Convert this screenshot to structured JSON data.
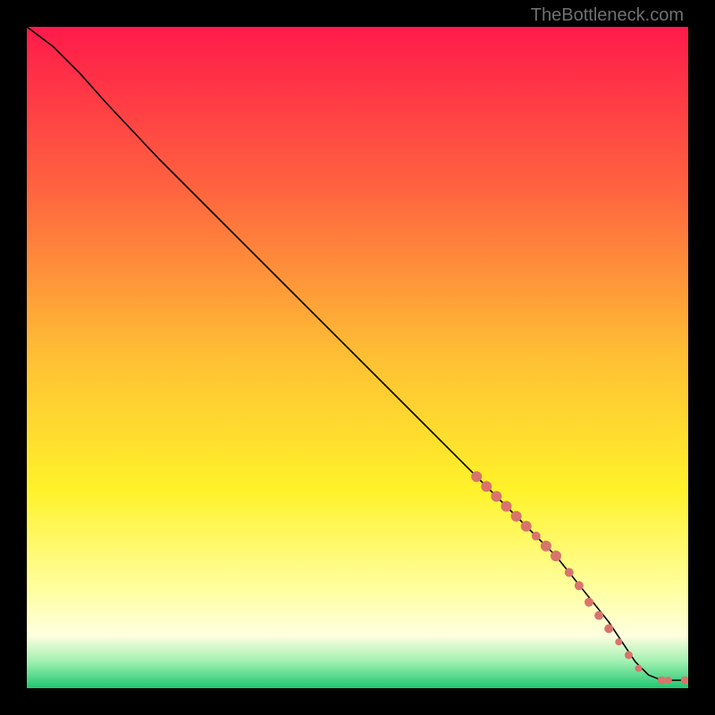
{
  "watermark": "TheBottleneck.com",
  "chart_data": {
    "type": "line",
    "title": "",
    "xlabel": "",
    "ylabel": "",
    "xlim": [
      0,
      100
    ],
    "ylim": [
      0,
      100
    ],
    "grid": false,
    "background_gradient": {
      "type": "vertical",
      "stops": [
        {
          "offset": 0.0,
          "color": "#ff1a4a"
        },
        {
          "offset": 0.25,
          "color": "#ff653f"
        },
        {
          "offset": 0.5,
          "color": "#ffc034"
        },
        {
          "offset": 0.7,
          "color": "#fff22a"
        },
        {
          "offset": 0.85,
          "color": "#ffffa0"
        },
        {
          "offset": 0.92,
          "color": "#ffffe0"
        },
        {
          "offset": 0.96,
          "color": "#a0f0b0"
        },
        {
          "offset": 1.0,
          "color": "#1fc76f"
        }
      ]
    },
    "series": [
      {
        "name": "curve",
        "type": "line",
        "color": "#000000",
        "width": 1.6,
        "points": [
          {
            "x": 0,
            "y": 100
          },
          {
            "x": 4,
            "y": 97
          },
          {
            "x": 8,
            "y": 93
          },
          {
            "x": 12,
            "y": 88.5
          },
          {
            "x": 20,
            "y": 80
          },
          {
            "x": 30,
            "y": 70
          },
          {
            "x": 40,
            "y": 60
          },
          {
            "x": 50,
            "y": 50
          },
          {
            "x": 60,
            "y": 40
          },
          {
            "x": 70,
            "y": 30
          },
          {
            "x": 80,
            "y": 20
          },
          {
            "x": 88,
            "y": 10
          },
          {
            "x": 92,
            "y": 4
          },
          {
            "x": 94,
            "y": 2
          },
          {
            "x": 96,
            "y": 1.2
          },
          {
            "x": 98,
            "y": 1.2
          },
          {
            "x": 100,
            "y": 1.2
          }
        ]
      },
      {
        "name": "markers",
        "type": "scatter",
        "color": "#d9746b",
        "radius_default": 5.5,
        "points": [
          {
            "x": 68,
            "y": 32,
            "r": 6
          },
          {
            "x": 69.5,
            "y": 30.5,
            "r": 6
          },
          {
            "x": 71,
            "y": 29,
            "r": 6
          },
          {
            "x": 72.5,
            "y": 27.5,
            "r": 6
          },
          {
            "x": 74,
            "y": 26,
            "r": 6
          },
          {
            "x": 75.5,
            "y": 24.5,
            "r": 6
          },
          {
            "x": 77,
            "y": 23,
            "r": 5
          },
          {
            "x": 78.5,
            "y": 21.5,
            "r": 6
          },
          {
            "x": 80,
            "y": 20,
            "r": 6
          },
          {
            "x": 82,
            "y": 17.5,
            "r": 5
          },
          {
            "x": 83.5,
            "y": 15.5,
            "r": 5
          },
          {
            "x": 85,
            "y": 13,
            "r": 5
          },
          {
            "x": 86.5,
            "y": 11,
            "r": 5
          },
          {
            "x": 88,
            "y": 9,
            "r": 5
          },
          {
            "x": 89.5,
            "y": 7,
            "r": 4
          },
          {
            "x": 91,
            "y": 5,
            "r": 4.5
          },
          {
            "x": 92.5,
            "y": 3,
            "r": 4
          },
          {
            "x": 96,
            "y": 1.2,
            "r": 4.5
          },
          {
            "x": 97,
            "y": 1.2,
            "r": 4
          },
          {
            "x": 99.5,
            "y": 1.2,
            "r": 4.5
          },
          {
            "x": 100.5,
            "y": 1.2,
            "r": 4
          }
        ]
      }
    ]
  }
}
